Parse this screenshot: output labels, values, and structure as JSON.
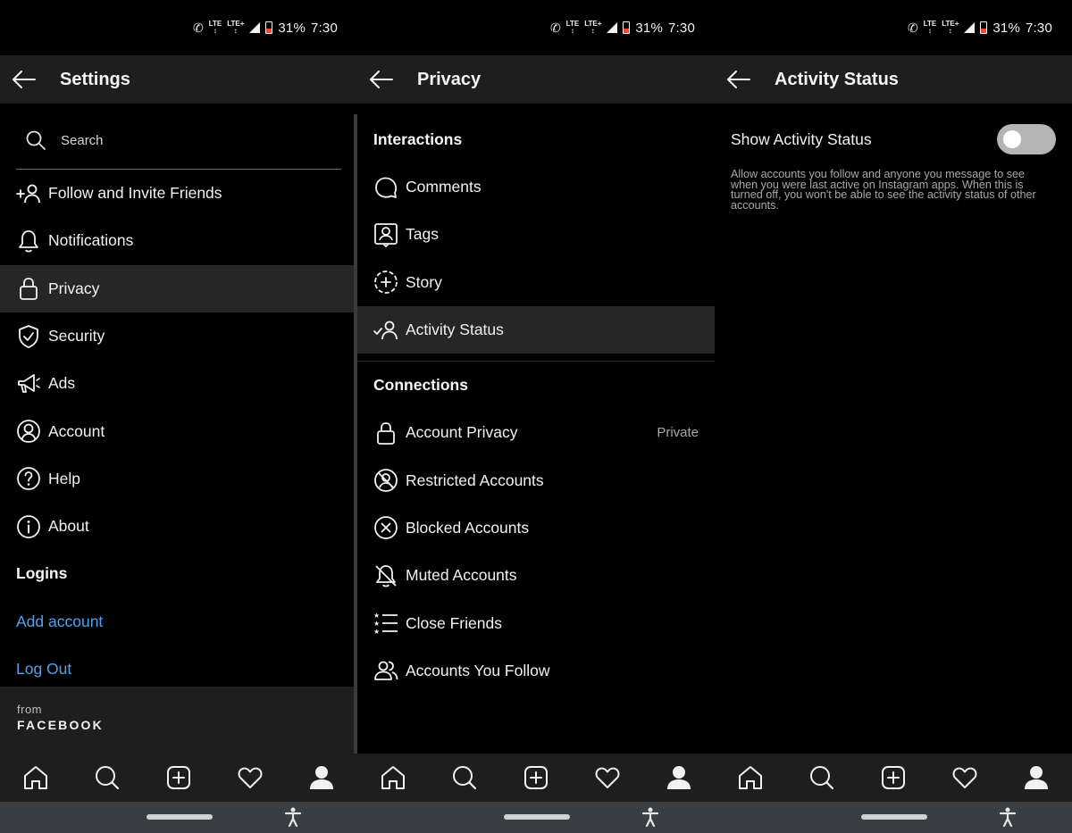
{
  "status_bar": {
    "net1": "LTE",
    "net2": "LTE+",
    "battery": "31%",
    "time": "7:30"
  },
  "settings_panel": {
    "title": "Settings",
    "search_placeholder": "Search",
    "items": [
      {
        "label": "Follow and Invite Friends",
        "icon": "add-person-icon"
      },
      {
        "label": "Notifications",
        "icon": "bell-icon"
      },
      {
        "label": "Privacy",
        "icon": "lock-icon"
      },
      {
        "label": "Security",
        "icon": "shield-icon"
      },
      {
        "label": "Ads",
        "icon": "megaphone-icon"
      },
      {
        "label": "Account",
        "icon": "account-circle-icon"
      },
      {
        "label": "Help",
        "icon": "help-icon"
      },
      {
        "label": "About",
        "icon": "info-icon"
      }
    ],
    "logins_heading": "Logins",
    "add_account": "Add account",
    "log_out": "Log Out",
    "from_label": "from",
    "brand_label": "FACEBOOK"
  },
  "privacy_panel": {
    "title": "Privacy",
    "interactions_heading": "Interactions",
    "interactions": [
      {
        "label": "Comments",
        "icon": "comment-icon"
      },
      {
        "label": "Tags",
        "icon": "tag-icon"
      },
      {
        "label": "Story",
        "icon": "story-icon"
      },
      {
        "label": "Activity Status",
        "icon": "activity-status-icon"
      }
    ],
    "connections_heading": "Connections",
    "connections": [
      {
        "label": "Account Privacy",
        "icon": "lock-icon",
        "value": "Private"
      },
      {
        "label": "Restricted Accounts",
        "icon": "restricted-icon"
      },
      {
        "label": "Blocked Accounts",
        "icon": "blocked-icon"
      },
      {
        "label": "Muted Accounts",
        "icon": "muted-bell-icon"
      },
      {
        "label": "Close Friends",
        "icon": "close-friends-icon"
      },
      {
        "label": "Accounts You Follow",
        "icon": "accounts-follow-icon"
      }
    ]
  },
  "activity_panel": {
    "title": "Activity Status",
    "toggle_label": "Show Activity Status",
    "toggle_on": false,
    "description": "Allow accounts you follow and anyone you message to see when you were last active on Instagram apps. When this is turned off, you won't be able to see the activity status of other accounts."
  },
  "bottom_nav": [
    "home-icon",
    "search-icon",
    "new-post-icon",
    "activity-heart-icon",
    "profile-icon"
  ],
  "colors": {
    "link": "#4ea3f1",
    "bar_bg": "#1e1e1e",
    "active_row": "#262626"
  }
}
